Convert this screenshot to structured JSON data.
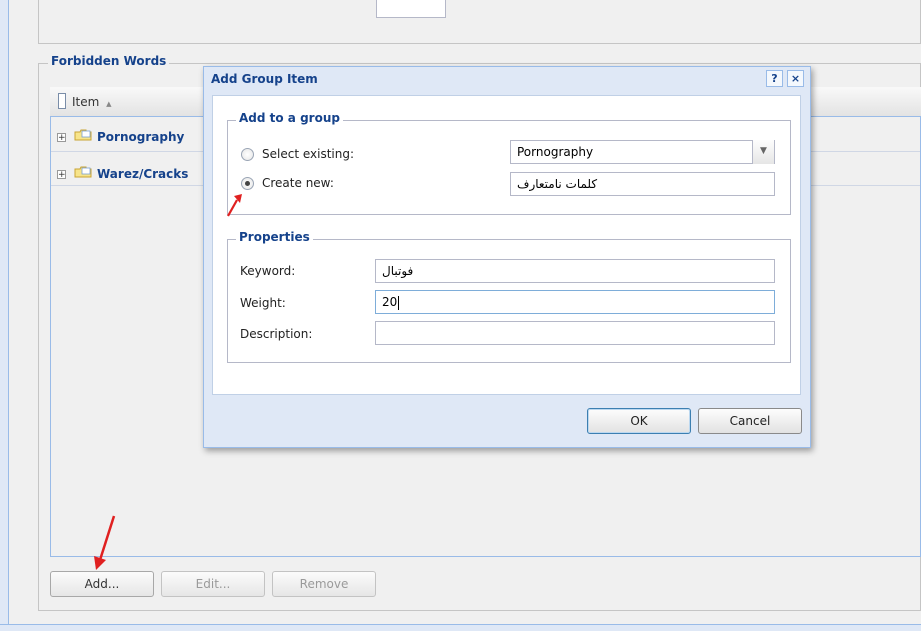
{
  "forbidden_words": {
    "legend": "Forbidden Words",
    "grid": {
      "column_header": "Item",
      "sort_indicator": "▲",
      "rows": [
        {
          "label": "Pornography"
        },
        {
          "label": "Warez/Cracks"
        }
      ]
    },
    "buttons": {
      "add": "Add...",
      "edit": "Edit...",
      "remove": "Remove"
    }
  },
  "dialog": {
    "title": "Add Group Item",
    "help_icon": "?",
    "close_icon": "×",
    "group_section": {
      "legend": "Add to a group",
      "select_existing_label": "Select existing:",
      "select_existing_value": "Pornography",
      "create_new_label": "Create new:",
      "create_new_value": "کلمات نامتعارف",
      "selected_option": "create_new"
    },
    "properties_section": {
      "legend": "Properties",
      "keyword_label": "Keyword:",
      "keyword_value": "فوتبال",
      "weight_label": "Weight:",
      "weight_value": "20",
      "description_label": "Description:",
      "description_value": ""
    },
    "ok_label": "OK",
    "cancel_label": "Cancel"
  },
  "colors": {
    "accent": "#15428b",
    "annotation_arrow": "#e02020",
    "panel_border": "#99bbe8"
  }
}
